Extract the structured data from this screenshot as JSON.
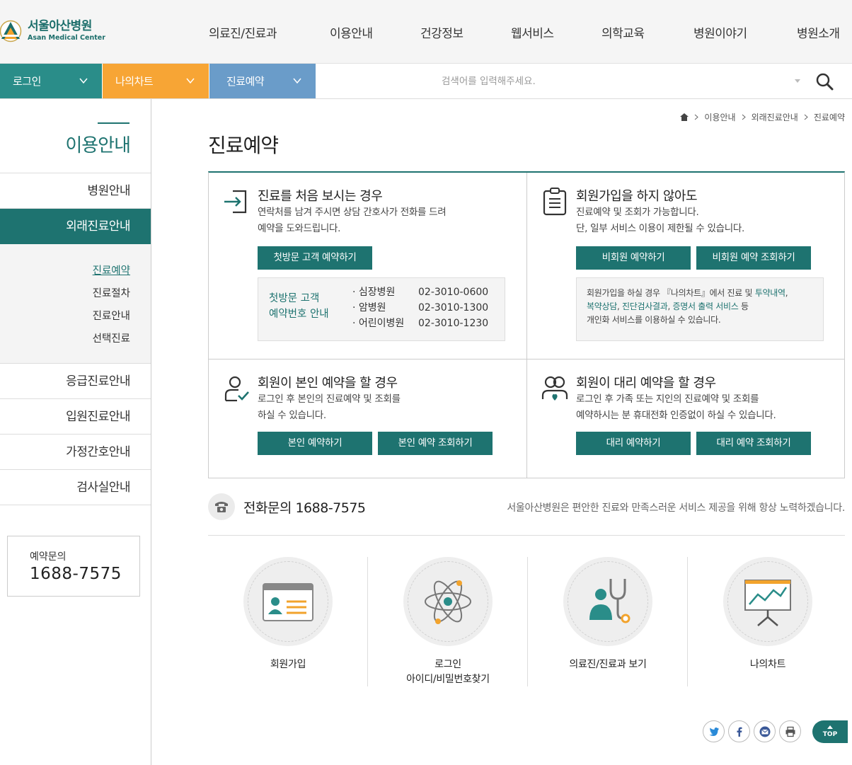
{
  "header": {
    "logo_kr": "서울아산병원",
    "logo_en": "Asan Medical Center",
    "nav": [
      "의료진/진료과",
      "이용안내",
      "건강정보",
      "웹서비스",
      "의학교육",
      "병원이야기",
      "병원소개"
    ]
  },
  "quickbar": {
    "login": "로그인",
    "mychart": "나의차트",
    "reserve": "진료예약",
    "search_placeholder": "검색어를 입력해주세요.",
    "colors": {
      "login": "#2a8d89",
      "mychart": "#f7a535",
      "reserve": "#6a9cc9"
    }
  },
  "sidebar": {
    "title": "이용안내",
    "items": [
      "병원안내",
      "외래진료안내",
      "응급진료안내",
      "입원진료안내",
      "가정간호안내",
      "검사실안내"
    ],
    "sub": [
      "진료예약",
      "진료절차",
      "진료안내",
      "선택진료"
    ],
    "call_label": "예약문의",
    "call_number": "1688-7575"
  },
  "breadcrumb": [
    "이용안내",
    "외래진료안내",
    "진료예약"
  ],
  "page_title": "진료예약",
  "cards": {
    "first": {
      "title": "진료를 처음 보시는 경우",
      "desc1": "연락처를 남겨 주시면 상담 간호사가 전화를 드려",
      "desc2": "예약을 도와드립니다.",
      "button": "첫방문 고객 예약하기",
      "info_title1": "첫방문 고객",
      "info_title2": "예약번호 안내",
      "phones": [
        {
          "name": "· 심장병원",
          "num": "02-3010-0600"
        },
        {
          "name": "· 암병원",
          "num": "02-3010-1300"
        },
        {
          "name": "· 어린이병원",
          "num": "02-3010-1230"
        }
      ]
    },
    "nonmember": {
      "title": "회원가입을 하지 않아도",
      "desc1": "진료예약 및 조회가 가능합니다.",
      "desc2": "단, 일부 서비스 이용이 제한될 수 있습니다.",
      "button1": "비회원 예약하기",
      "button2": "비회원 예약 조회하기",
      "note_a": "회원가입을 하실 경우 『나의차트』에서 진료 및 ",
      "note_hl1": "투약내역",
      "note_b": ",",
      "note_hl2": "복약상담",
      "note_c": ", ",
      "note_hl3": "진단검사결과",
      "note_d": ", ",
      "note_hl4": "증명서 출력 서비스",
      "note_e": " 등",
      "note_line3": "개인화 서비스를 이용하실 수 있습니다."
    },
    "self": {
      "title": "회원이 본인 예약을 할 경우",
      "desc1": "로그인 후 본인의 진료예약 및 조회를",
      "desc2": "하실 수 있습니다.",
      "button1": "본인 예약하기",
      "button2": "본인 예약 조회하기"
    },
    "proxy": {
      "title": "회원이 대리 예약을 할 경우",
      "desc1": "로그인 후 가족 또는 지인의 진료예약 및 조회를",
      "desc2": "예약하시는 분 휴대전화 인증없이 하실 수 있습니다.",
      "button1": "대리 예약하기",
      "button2": "대리 예약 조회하기"
    }
  },
  "phonebar": {
    "label": "전화문의 1688-7575",
    "message": "서울아산병원은 편안한 진료와 만족스러운 서비스 제공을 위해 항상 노력하겠습니다."
  },
  "quicklinks": [
    {
      "label1": "회원가입",
      "label2": ""
    },
    {
      "label1": "로그인",
      "label2": "아이디/비밀번호찾기"
    },
    {
      "label1": "의료진/진료과 보기",
      "label2": ""
    },
    {
      "label1": "나의차트",
      "label2": ""
    }
  ],
  "top_label": "TOP"
}
